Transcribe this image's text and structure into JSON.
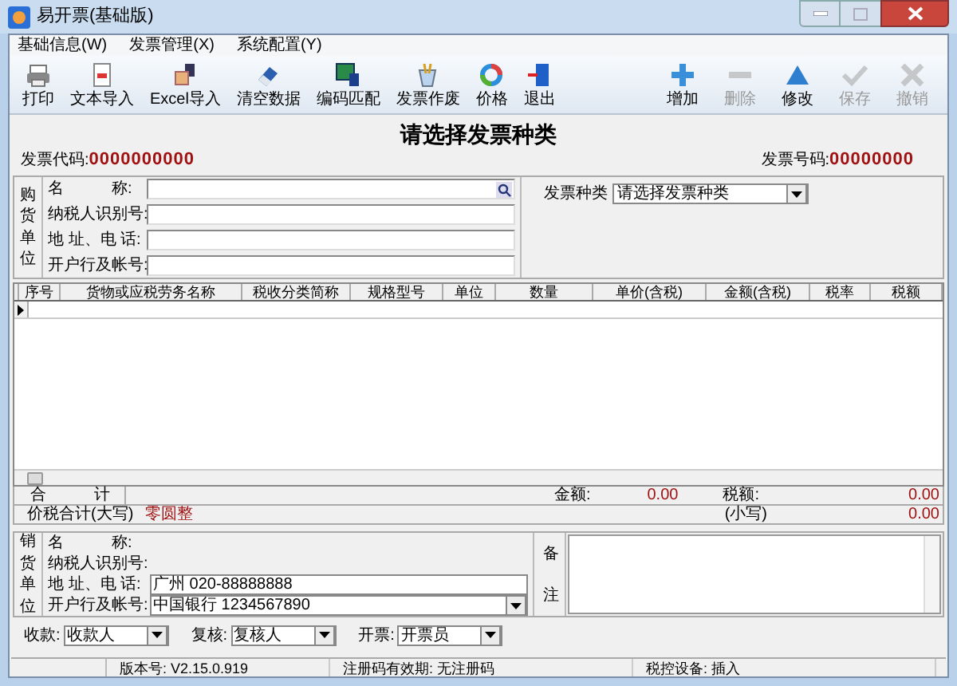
{
  "window": {
    "title": "易开票(基础版)"
  },
  "menu": [
    "基础信息(W)",
    "发票管理(X)",
    "系统配置(Y)"
  ],
  "toolbar_left": [
    {
      "label": "打印",
      "kind": "printer",
      "disabled": false
    },
    {
      "label": "文本导入",
      "kind": "document",
      "disabled": false
    },
    {
      "label": "Excel导入",
      "kind": "hand",
      "disabled": false
    },
    {
      "label": "清空数据",
      "kind": "eraser",
      "disabled": false
    },
    {
      "label": "编码匹配",
      "kind": "monitor",
      "disabled": false
    },
    {
      "label": "发票作废",
      "kind": "cup",
      "disabled": false
    },
    {
      "label": "价格",
      "kind": "ring",
      "disabled": false
    },
    {
      "label": "退出",
      "kind": "door",
      "disabled": false
    }
  ],
  "toolbar_right": [
    {
      "label": "增加",
      "kind": "plus",
      "disabled": false
    },
    {
      "label": "删除",
      "kind": "minus",
      "disabled": true
    },
    {
      "label": "修改",
      "kind": "triangle",
      "disabled": false
    },
    {
      "label": "保存",
      "kind": "check",
      "disabled": true
    },
    {
      "label": "撤销",
      "kind": "cross",
      "disabled": true
    }
  ],
  "heading": "请选择发票种类",
  "invoice_code": {
    "label": "发票代码:",
    "value": "0000000000"
  },
  "invoice_number": {
    "label": "发票号码:",
    "value": "00000000"
  },
  "buyer": {
    "side_label": "购货单位",
    "fields": [
      {
        "label": "名　　　称:",
        "kind": "lookup"
      },
      {
        "label": "纳税人识别号:",
        "kind": "text"
      },
      {
        "label": "地 址、电 话:",
        "kind": "text"
      },
      {
        "label": "开户行及帐号:",
        "kind": "text"
      }
    ]
  },
  "invoice_type": {
    "label": "发票种类",
    "value": "请选择发票种类"
  },
  "table": {
    "columns": [
      "序号",
      "货物或应税劳务名称",
      "税收分类简称",
      "规格型号",
      "单位",
      "数量",
      "单价(含税)",
      "金额(含税)",
      "税率",
      "税额"
    ]
  },
  "totals": {
    "label": "合　　　计",
    "amount_label": "金额:",
    "amount": "0.00",
    "tax_label": "税额:",
    "tax": "0.00"
  },
  "total_words": {
    "label": "价税合计(大写)",
    "value": "零圆整",
    "small_label": "(小写)",
    "small_value": "0.00"
  },
  "seller": {
    "side_label": "销货单位",
    "fields": [
      {
        "label": "名　　　称:",
        "kind": "plain"
      },
      {
        "label": "纳税人识别号:",
        "kind": "plain"
      },
      {
        "label": "地 址、电 话:",
        "kind": "text",
        "value": "广州 020-88888888"
      },
      {
        "label": "开户行及帐号:",
        "kind": "dropdown",
        "value": "中国银行 1234567890"
      }
    ]
  },
  "remarks": {
    "label_top": "备",
    "label_bottom": "注"
  },
  "signers": [
    {
      "label": "收款:",
      "value": "收款人"
    },
    {
      "label": "复核:",
      "value": "复核人"
    },
    {
      "label": "开票:",
      "value": "开票员"
    }
  ],
  "status_bar": [
    "版本号: V2.15.0.919",
    "注册码有效期: 无注册码",
    "税控设备: 插入"
  ]
}
